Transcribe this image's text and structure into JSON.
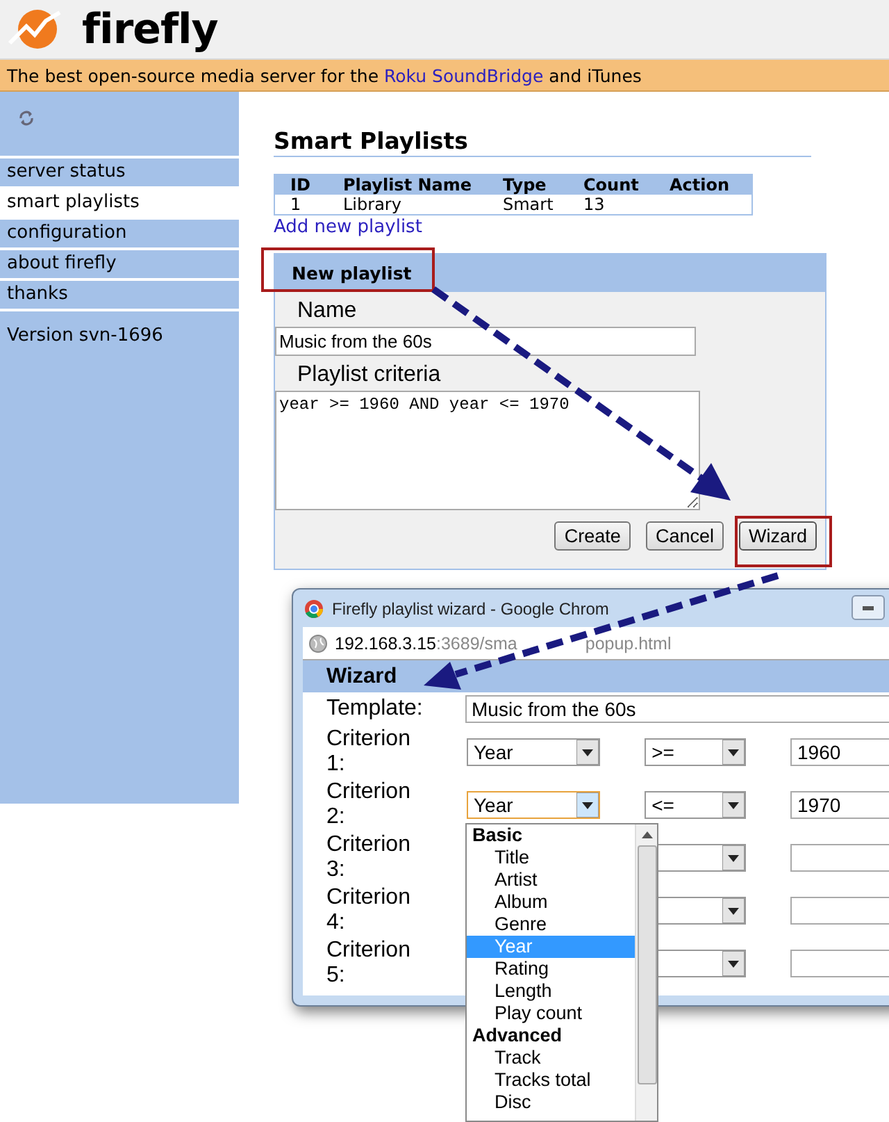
{
  "header": {
    "logo_text": "firefly"
  },
  "tagline": {
    "before": "The best open-source media server for the ",
    "link": "Roku SoundBridge",
    "after": " and iTunes"
  },
  "sidebar": {
    "items": [
      {
        "label": "server status",
        "selected": false
      },
      {
        "label": "smart playlists",
        "selected": true
      },
      {
        "label": "configuration",
        "selected": false
      },
      {
        "label": "about firefly",
        "selected": false
      },
      {
        "label": "thanks",
        "selected": false
      }
    ],
    "version": "Version svn-1696"
  },
  "content": {
    "title": "Smart Playlists",
    "table": {
      "columns": [
        "ID",
        "Playlist Name",
        "Type",
        "Count",
        "Action"
      ],
      "rows": [
        [
          "1",
          "Library",
          "Smart",
          "13"
        ]
      ]
    },
    "add_link": "Add new playlist",
    "new_playlist": {
      "title": "New playlist",
      "name_label": "Name",
      "name_value": "Music from the 60s",
      "criteria_label": "Playlist criteria",
      "criteria_value": "year >= 1960 AND year <= 1970",
      "buttons": [
        {
          "label": "Create",
          "highlighted": false
        },
        {
          "label": "Cancel",
          "highlighted": false
        },
        {
          "label": "Wizard",
          "highlighted": true
        }
      ]
    }
  },
  "popup": {
    "title": "Firefly playlist wizard - Google Chrom",
    "url_host": "192.168.3.15",
    "url_rest": ":3689/sma",
    "url_tail": "popup.html",
    "heading": "Wizard",
    "template_label": "Template:",
    "template_value": "Music from the 60s",
    "criteria": [
      {
        "label": "Criterion 1:",
        "field": "Year",
        "op": ">=",
        "value": "1960",
        "focused": false
      },
      {
        "label": "Criterion 2:",
        "field": "Year",
        "op": "<=",
        "value": "1970",
        "focused": true
      },
      {
        "label": "Criterion 3:"
      },
      {
        "label": "Criterion 4:"
      },
      {
        "label": "Criterion 5:"
      }
    ],
    "dropdown": {
      "groups": [
        {
          "label": "Basic",
          "options": [
            {
              "label": "Title",
              "selected": false
            },
            {
              "label": "Artist",
              "selected": false
            },
            {
              "label": "Album",
              "selected": false
            },
            {
              "label": "Genre",
              "selected": false
            },
            {
              "label": "Year",
              "selected": true
            },
            {
              "label": "Rating",
              "selected": false
            },
            {
              "label": "Length",
              "selected": false
            },
            {
              "label": "Play count",
              "selected": false
            }
          ]
        },
        {
          "label": "Advanced",
          "options": [
            {
              "label": "Track",
              "selected": false
            },
            {
              "label": "Tracks total",
              "selected": false
            },
            {
              "label": "Disc",
              "selected": false
            }
          ]
        }
      ]
    }
  }
}
